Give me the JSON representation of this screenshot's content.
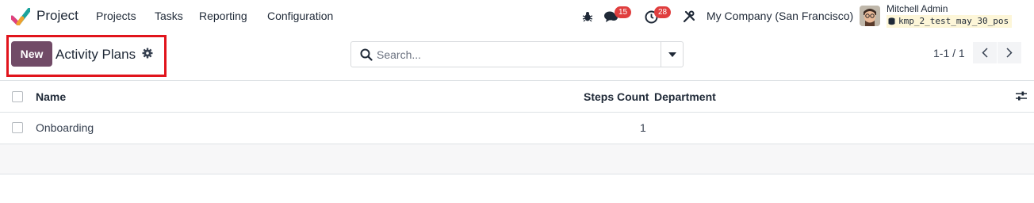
{
  "navbar": {
    "app_name": "Project",
    "menu": [
      "Projects",
      "Tasks",
      "Reporting",
      "Configuration"
    ],
    "messages_count": "15",
    "activities_count": "28",
    "company": "My Company (San Francisco)",
    "user_name": "Mitchell Admin",
    "database": "kmp_2_test_may_30_pos"
  },
  "control_panel": {
    "new_label": "New",
    "title": "Activity Plans",
    "search_placeholder": "Search...",
    "pager": "1-1 / 1"
  },
  "table": {
    "columns": [
      "Name",
      "Steps Count",
      "Department"
    ],
    "rows": [
      {
        "name": "Onboarding",
        "steps_count": "1",
        "department": ""
      }
    ]
  },
  "colors": {
    "brand": "#714b67",
    "badge": "#e03e3e",
    "highlight": "#e1141c"
  },
  "icons": [
    "app-logo-icon",
    "bug-icon",
    "chat-icon",
    "clock-icon",
    "tools-icon",
    "avatar",
    "database-icon",
    "gear-icon",
    "search-icon",
    "caret-down-icon",
    "chevron-left-icon",
    "chevron-right-icon",
    "sliders-icon"
  ]
}
